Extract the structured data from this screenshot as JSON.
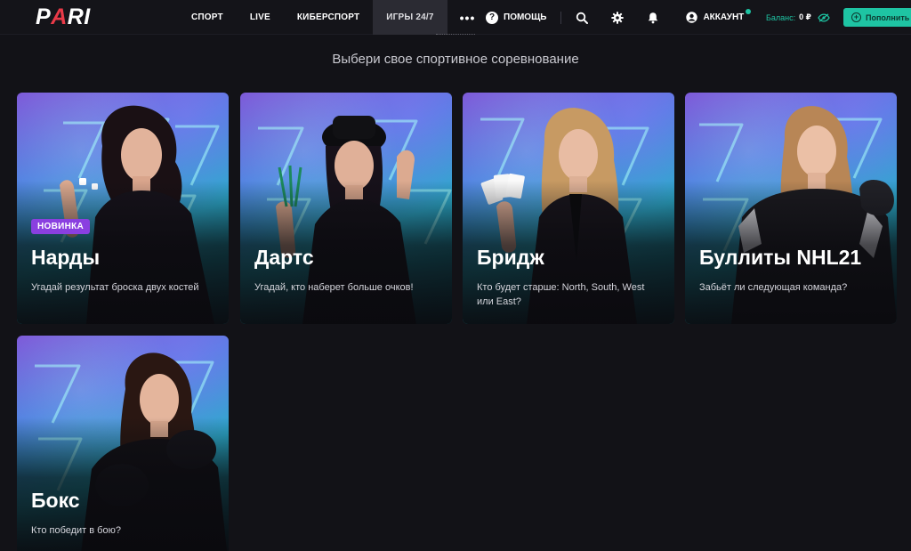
{
  "header": {
    "logo": {
      "text_main": "P",
      "text_accent": "A",
      "text_rest": "RI"
    },
    "nav": [
      {
        "label": "СПОРТ",
        "active": false
      },
      {
        "label": "LIVE",
        "active": false
      },
      {
        "label": "КИБЕРСПОРТ",
        "active": false
      },
      {
        "label": "ИГРЫ 24/7",
        "active": true
      },
      {
        "label": "•••",
        "active": false
      }
    ],
    "help_label": "ПОМОЩЬ",
    "account_label": "АККАУНТ",
    "balance_label": "Баланс:",
    "balance_value": "0 ₽",
    "deposit_label": "Пополнить"
  },
  "page_title": "Выбери свое спортивное соревнование",
  "cards": [
    {
      "title": "Нарды",
      "desc": "Угадай результат броска двух костей",
      "badge": "НОВИНКА"
    },
    {
      "title": "Дартс",
      "desc": "Угадай, кто наберет больше очков!"
    },
    {
      "title": "Бридж",
      "desc": "Кто будет старше: North, South, West или East?"
    },
    {
      "title": "Буллиты NHL21",
      "desc": "Забьёт ли следующая команда?"
    },
    {
      "title": "Бокс",
      "desc": "Кто победит в бою?"
    }
  ],
  "colors": {
    "accent_green": "#1ec4a3",
    "badge_purple": "#8a3fe0",
    "background": "#121217",
    "logo_red": "#e93a48"
  }
}
